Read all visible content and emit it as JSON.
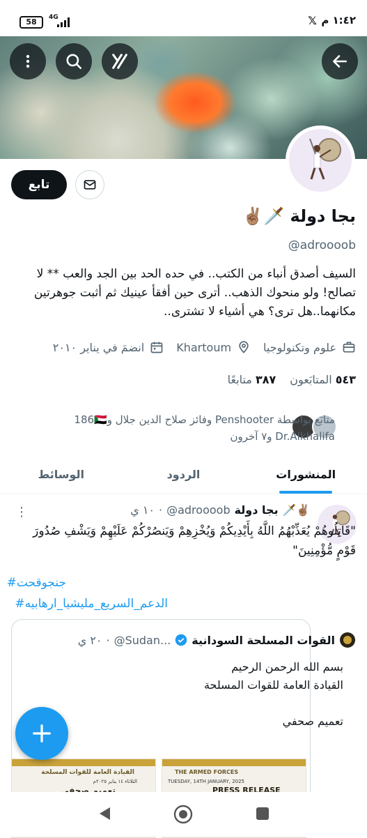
{
  "status_bar": {
    "battery": "58",
    "network": "4G",
    "time": "١:٤٢ م",
    "icons": [
      "battery-icon",
      "signal-icon",
      "x-app-icon"
    ]
  },
  "header": {
    "icons": [
      "back-arrow-icon",
      "grok-icon",
      "search-icon",
      "more-vertical-icon"
    ]
  },
  "profile": {
    "follow_label": "تابع",
    "name": "بجا دولة 🗡️✌🏽",
    "handle": "@adroooob",
    "bio": "السيف أصدق أنباء من الكتب.. في حده الحد بين الجد والعب ** لا تصالح! ولو منحوك الذهب.. أترى حين أفقأ عينيك ثم أثبت جوهرتين مكانهما..هل ترى؟ هي أشياء لا تشترى..",
    "category": "علوم وتكنولوجيا",
    "location": "Khartoum",
    "joined": "انضمَ في يناير ٢٠١٠",
    "following_count": "٣٨٧",
    "following_label": "متابعًا",
    "followers_count": "٥٤٣",
    "followers_label": "المتابَعون",
    "followed_by": "متابَع بواسطة Penshooter وفائز صلاح الدين جلال و186🇸🇩 Dr.Alkhalifa و٧ آخرون"
  },
  "tabs": [
    {
      "label": "المنشورات",
      "active": true
    },
    {
      "label": "الردود",
      "active": false
    },
    {
      "label": "الوسائط",
      "active": false
    }
  ],
  "post": {
    "author_name": "بجا دولة 🗡️✌🏽",
    "author_handle": "@adroooob",
    "time": "١٠ ي",
    "text": "\"قَاتِلُوهُمْ يُعَذِّبْهُمُ اللَّهُ بِأَيْدِيكُمْ وَيُخْزِهِمْ وَيَنصُرْكُمْ عَلَيْهِمْ وَيَشْفِ صُدُورَ قَوْمٍ مُّؤْمِنِينَ\"",
    "hashtags": [
      "#جنجوقحت",
      "#الدعم_السريع_مليشيا_ارهابيه"
    ],
    "quote": {
      "name": "القوات المسلحة السودانية",
      "handle": "@Sudan...",
      "time": "٢٠ ي",
      "text": "بسم الله الرحمن الرحيم\nالقيادة العامة للقوات المسلحة\n\nتعميم صحفي",
      "thumbs": [
        {
          "title": "PRESS RELEASE",
          "header": "THE ARMED FORCES",
          "date": "TUESDAY, 14TH JANUARY, 2025"
        },
        {
          "title": "تعميم صحفي",
          "header": "القيادة العامة للقوات المسلحة",
          "date": "الثلاثاء ١٤ يناير ٢٠٢٥م"
        }
      ]
    }
  },
  "colors": {
    "accent": "#1d9bf0",
    "text": "#0f1419",
    "muted": "#536471",
    "border": "#cfd9de"
  }
}
